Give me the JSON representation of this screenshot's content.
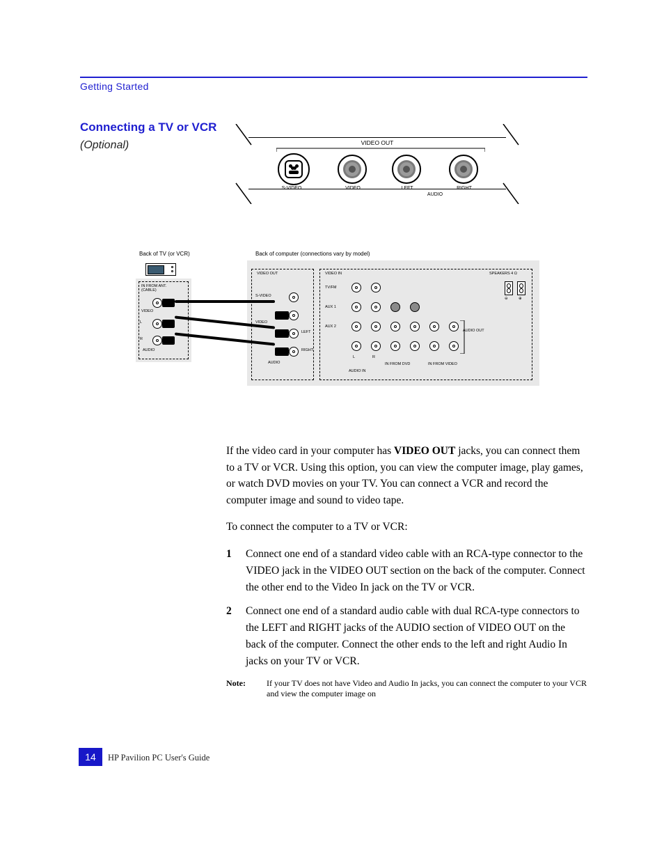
{
  "header": {
    "section_title": "Getting Started"
  },
  "left": {
    "heading": "Connecting a TV or VCR",
    "subtitle": "(Optional)"
  },
  "diagram1": {
    "group_label": "VIDEO OUT",
    "svideo_label": "S-VIDEO",
    "video_label": "VIDEO",
    "left_label": "LEFT",
    "right_label": "RIGHT",
    "audio_label": "AUDIO"
  },
  "diagram2": {
    "caption_left": "Back of TV (or VCR)",
    "caption_right": "Back of computer (connections vary by model)",
    "tv_in_label": "IN FROM ANT.\n(CABLE)",
    "tv_video_label": "VIDEO",
    "tv_audio_label": "AUDIO",
    "tv_l": "L",
    "tv_r": "R",
    "pc_video_in": "VIDEO IN",
    "pc_video_out": "VIDEO OUT",
    "pc_svideo": "S-VIDEO",
    "pc_video": "VIDEO",
    "pc_left": "LEFT",
    "pc_right": "RIGHT",
    "pc_audio": "AUDIO",
    "pc_tvfm": "TV/FM",
    "pc_l": "L",
    "pc_r": "R",
    "pc_aux1": "AUX 1",
    "pc_aux2": "AUX 2",
    "pc_dvd": "IN FROM DVD",
    "pc_video_aux": "IN FROM VIDEO",
    "pc_audio_in": "AUDIO IN",
    "pc_audio_out": "AUDIO OUT",
    "pc_speakers": "SPEAKERS 4 Ω"
  },
  "body": {
    "p1_a": "If the video card in your computer has ",
    "p1_b": "VIDEO OUT",
    "p1_c": " jacks, you can connect them to a TV or VCR. Using this option, you can view the computer image, play games, or watch DVD movies on your TV. You can connect a VCR and record the computer image and sound to video tape.",
    "p2": "To connect the computer to a TV or VCR:",
    "step1_n": "1",
    "step1": "Connect one end of a standard video cable with an RCA-type connector to the VIDEO jack in the VIDEO OUT section on the back of the computer. Connect the other end to the Video In jack on the TV or VCR.",
    "step2_n": "2",
    "step2": "Connect one end of a standard audio cable with dual RCA-type connectors to the LEFT and RIGHT jacks of the AUDIO section of VIDEO OUT on the back of the computer. Connect the other ends to the left and right Audio In jacks on your TV or VCR.",
    "note_label": "Note:",
    "note_text": "If your TV does not have Video and Audio In jacks, you can connect the computer to your VCR and view the computer image on"
  },
  "page_number": "14",
  "footer": "HP Pavilion PC User's Guide"
}
